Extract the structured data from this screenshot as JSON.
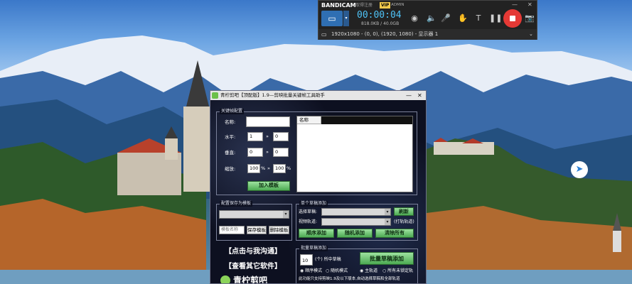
{
  "bandicam": {
    "brand": "BANDICAM",
    "register_label": "取得注册",
    "vip_label": "VIP",
    "admin_label": "ADMIN",
    "timer": "00:00:04",
    "file_size": "818.0KB / 40.0GB",
    "resolution_text": "1920x1080 - (0, 0), (1920, 1080) - 显示器 1",
    "colors": {
      "record": "#e53935",
      "timer": "#4fc3f7"
    }
  },
  "window": {
    "title": "青柠剪吧【顶配版】1.9—剪映批量关键帧工具助手"
  },
  "keyframe_group": {
    "title": "关键帧配置",
    "name_label": "名称:",
    "horizontal_label": "水平:",
    "vertical_label": "垂直:",
    "scale_label": "缩放:",
    "h_from": "1",
    "h_to": "0",
    "v_from": "0",
    "v_to": "0",
    "s_from": "100",
    "s_to": "100",
    "percent": "%",
    "arrow": "»",
    "add_button": "加入模板",
    "list_header": "名称"
  },
  "save_group": {
    "title": "配置保存为模板",
    "name_placeholder": "模板名称",
    "save_button": "保存模板",
    "delete_button": "删除模板"
  },
  "single_group": {
    "title": "单个草稿添加",
    "draft_label": "选择草稿:",
    "track_label": "视频轨道:",
    "refresh_button": "刷新",
    "track_hint": "(打轨轨道)",
    "random_add_button": "顺序添加",
    "random_keyframe_button": "随机添加",
    "clear_button": "清除所有"
  },
  "batch_group": {
    "title": "批量草稿添加",
    "count_value": "10",
    "count_label": "(个) 所中草稿",
    "batch_button": "批量草稿添加",
    "radio_sequence": "顺序模式",
    "radio_random": "随机模式",
    "radio_main_track": "主轨道",
    "radio_all_tracks": "所有未锁定轨",
    "note": "此功能只支持剪映1.9及以下版本,自动选择草稿和全部轨道"
  },
  "links": {
    "contact": "【点击与我沟通】",
    "other_software": "【查看其它软件】",
    "brand_footer": "青柠剪吧"
  }
}
